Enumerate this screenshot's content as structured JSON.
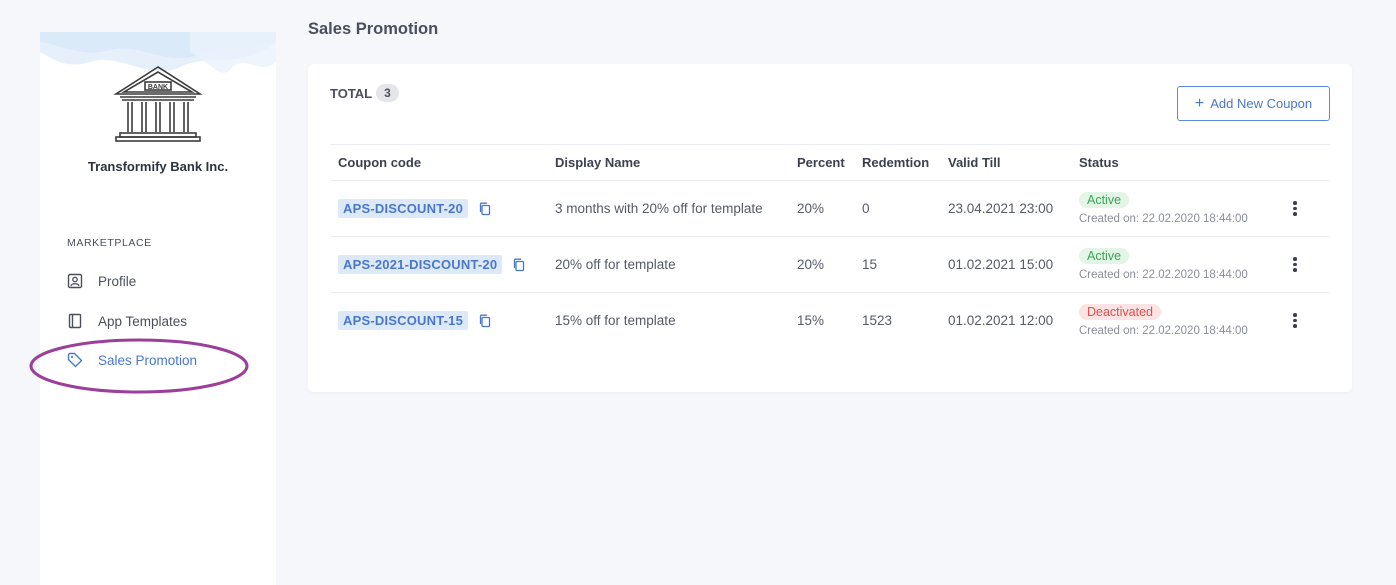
{
  "sidebar": {
    "org_name": "Transformify Bank Inc.",
    "logo_text": "BANK",
    "section_label": "MARKETPLACE",
    "items": [
      {
        "label": "Profile",
        "icon": "profile-icon"
      },
      {
        "label": "App Templates",
        "icon": "book-icon"
      },
      {
        "label": "Sales Promotion",
        "icon": "tag-icon",
        "active": true
      }
    ]
  },
  "page": {
    "title": "Sales Promotion"
  },
  "summary": {
    "total_label": "TOTAL",
    "total_count": "3"
  },
  "actions": {
    "add_label": "Add New Coupon"
  },
  "table": {
    "columns": [
      "Coupon code",
      "Display Name",
      "Percent",
      "Redemtion",
      "Valid Till",
      "Status"
    ],
    "rows": [
      {
        "code": "APS-DISCOUNT-20",
        "name": "3 months with 20% off for template",
        "percent": "20%",
        "redemption": "0",
        "valid_till": "23.04.2021 23:00",
        "status": "Active",
        "created": "Created on: 22.02.2020 18:44:00"
      },
      {
        "code": "APS-2021-DISCOUNT-20",
        "name": "20% off for template",
        "percent": "20%",
        "redemption": "15",
        "valid_till": "01.02.2021 15:00",
        "status": "Active",
        "created": "Created on: 22.02.2020 18:44:00"
      },
      {
        "code": "APS-DISCOUNT-15",
        "name": "15% off for template",
        "percent": "15%",
        "redemption": "1523",
        "valid_till": "01.02.2021 12:00",
        "status": "Deactivated",
        "created": "Created on: 22.02.2020 18:44:00"
      }
    ]
  },
  "colors": {
    "accent": "#4a78c8",
    "active": "#3aa656",
    "deactivated": "#d9534f",
    "highlight": "#9b3f9a"
  }
}
